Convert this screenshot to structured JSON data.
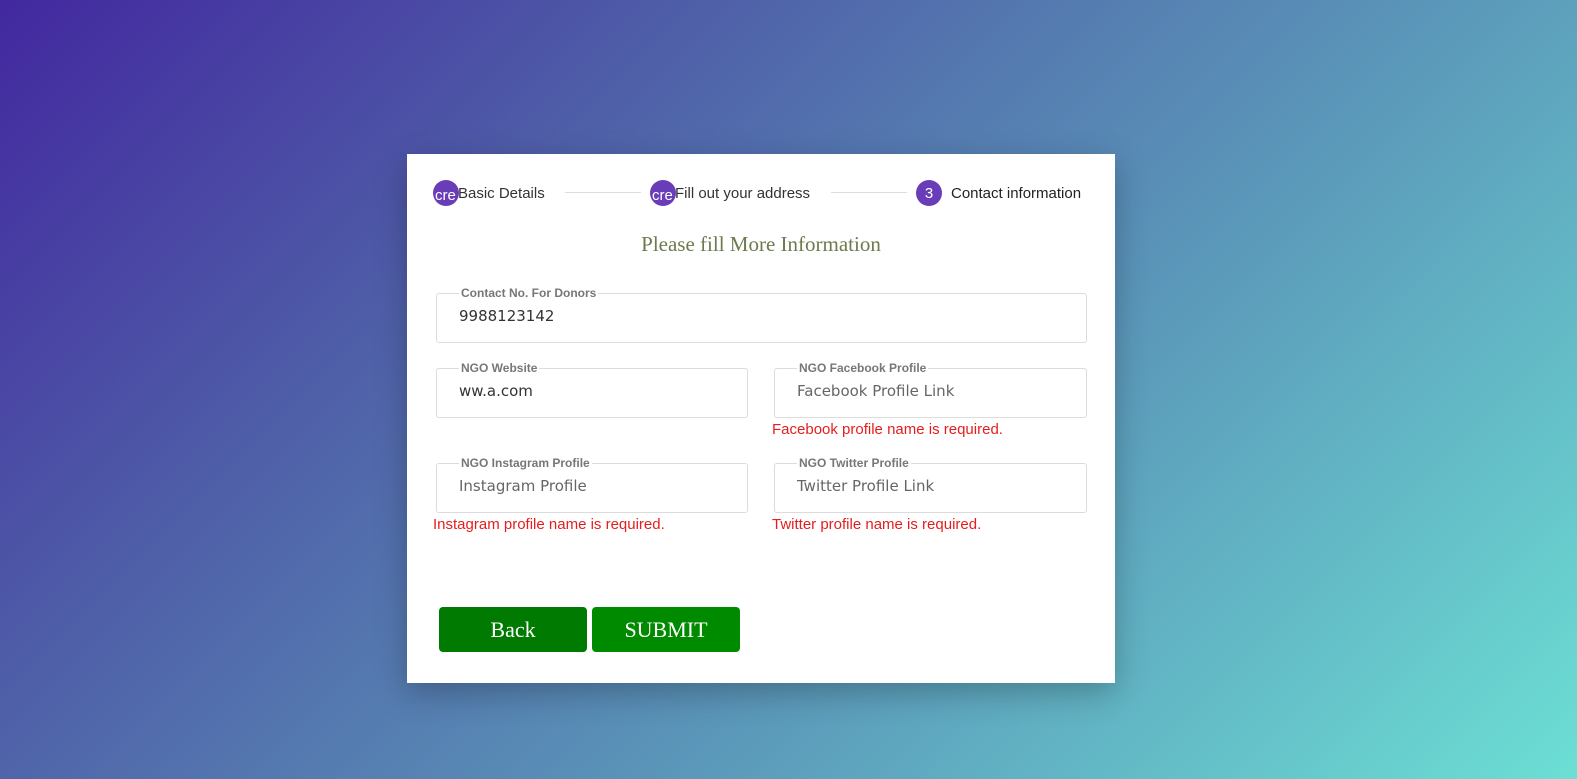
{
  "stepper": {
    "steps": [
      {
        "number": "cre",
        "label": "Basic Details"
      },
      {
        "number": "cre",
        "label": "Fill out your address"
      },
      {
        "number": "3",
        "label": "Contact information"
      }
    ]
  },
  "form": {
    "heading": "Please fill More Information",
    "contact": {
      "label": "Contact No. For Donors",
      "value": "9988123142",
      "placeholder": ""
    },
    "website": {
      "label": "NGO Website",
      "value": "ww.a.com",
      "placeholder": ""
    },
    "facebook": {
      "label": "NGO Facebook Profile",
      "value": "",
      "placeholder": "Facebook Profile Link",
      "error": "Facebook profile name is required."
    },
    "instagram": {
      "label": "NGO Instagram Profile",
      "value": "",
      "placeholder": "Instagram Profile",
      "error": "Instagram profile name is required."
    },
    "twitter": {
      "label": "NGO Twitter Profile",
      "value": "",
      "placeholder": "Twitter Profile Link",
      "error": "Twitter profile name is required."
    }
  },
  "buttons": {
    "back": {
      "label": "Back",
      "color": "#007a00"
    },
    "submit": {
      "label": "SUBMIT",
      "color": "#008a00"
    }
  },
  "colors": {
    "step_accent": "#6a3db8",
    "error": "#e41e1e"
  }
}
